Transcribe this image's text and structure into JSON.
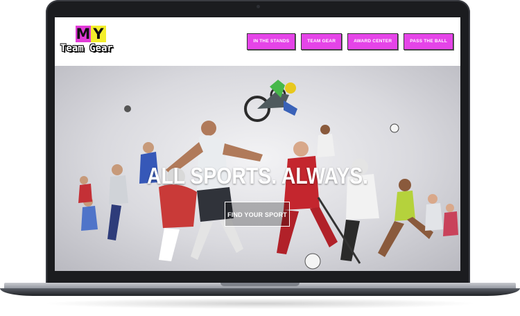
{
  "brand": {
    "logo_letter_1": "M",
    "logo_letter_2": "Y",
    "logo_text": "Team Gear",
    "accent_color": "#e544e8",
    "logo_yellow": "#f3ee2b"
  },
  "nav": {
    "items": [
      {
        "label": "IN THE STANDS"
      },
      {
        "label": "TEAM GEAR"
      },
      {
        "label": "AWARD CENTER"
      },
      {
        "label": "PASS THE BALL"
      }
    ]
  },
  "hero": {
    "heading": "ALL SPORTS. ALWAYS.",
    "cta_label": "FIND YOUR SPORT"
  }
}
